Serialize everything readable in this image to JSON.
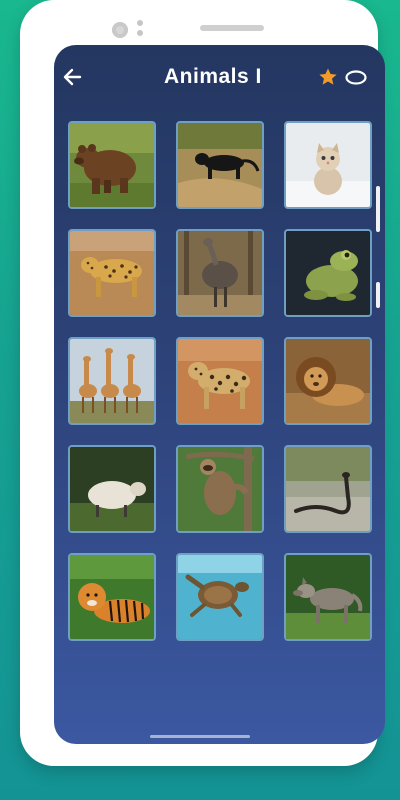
{
  "header": {
    "title": "Animals I",
    "star_color": "#f39b28",
    "back_icon": "arrow-left-icon",
    "score_icon": "ring-icon"
  },
  "grid": {
    "tiles": [
      {
        "animal": "brown-bear"
      },
      {
        "animal": "black-panther"
      },
      {
        "animal": "kitten"
      },
      {
        "animal": "leopard"
      },
      {
        "animal": "emu"
      },
      {
        "animal": "frog"
      },
      {
        "animal": "giraffes"
      },
      {
        "animal": "jaguar"
      },
      {
        "animal": "lion"
      },
      {
        "animal": "sheep"
      },
      {
        "animal": "sloth"
      },
      {
        "animal": "snake"
      },
      {
        "animal": "tiger"
      },
      {
        "animal": "sea-turtle"
      },
      {
        "animal": "wolf"
      }
    ]
  }
}
